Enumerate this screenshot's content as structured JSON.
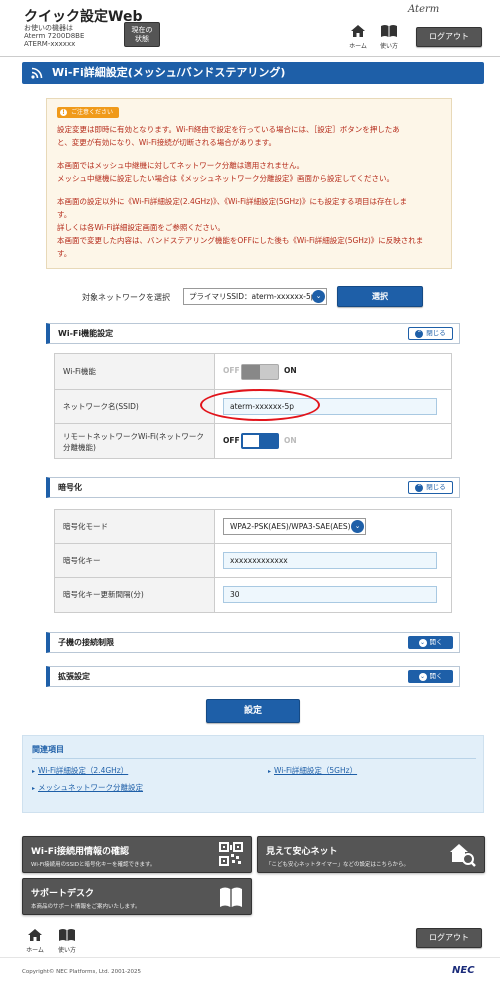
{
  "header": {
    "app_title": "クイック設定Web",
    "device_line1": "お使いの機器は",
    "device_line2": "Aterm 7200D8BE",
    "device_line3": "ATERM-xxxxxx",
    "status_button": [
      "現在の",
      "状態"
    ],
    "home_label": "ホーム",
    "help_label": "使い方",
    "brand": "Aterm",
    "logout": "ログアウト"
  },
  "page": {
    "title": "Wi-Fi詳細設定(メッシュ/バンドステアリング)"
  },
  "notice": {
    "badge": "ご注意ください",
    "lines": [
      "設定変更は即時に有効となります。Wi-Fi経由で設定を行っている場合には、［設定］ボタンを押したあ",
      "と、変更が有効になり、Wi-Fi接続が切断される場合があります。",
      "本画面ではメッシュ中継機に対してネットワーク分離は適用されません。",
      "メッシュ中継機に設定したい場合は《メッシュネットワーク分離設定》画面から設定してください。",
      "本画面の設定以外に《Wi-Fi詳細設定(2.4GHz)》、《Wi-Fi詳細設定(5GHz)》にも設定する項目は存在しま",
      "す。",
      "詳しくは各Wi-Fi詳細設定画面をご参照ください。",
      "本画面で変更した内容は、バンドステアリング機能をOFFにした後も《Wi-Fi詳細設定(5GHz)》に反映されま",
      "す。"
    ]
  },
  "network_select": {
    "label": "対象ネットワークを選択",
    "value": "プライマリSSID：aterm-xxxxxx-5p",
    "button": "選択"
  },
  "wifi_section": {
    "title": "Wi-Fi機能設定",
    "toggle": "閉じる",
    "rows": {
      "wifi_function": {
        "label": "Wi-Fi機能",
        "off": "OFF",
        "on": "ON",
        "state": "on"
      },
      "ssid": {
        "label": "ネットワーク名(SSID)",
        "value": "aterm-xxxxxx-5p"
      },
      "remote_network": {
        "label": "リモートネットワークWi-Fi(ネットワーク分離機能)",
        "off": "OFF",
        "on": "ON",
        "state": "off"
      }
    }
  },
  "encryption_section": {
    "title": "暗号化",
    "toggle": "閉じる",
    "rows": {
      "mode": {
        "label": "暗号化モード",
        "value": "WPA2-PSK(AES)/WPA3-SAE(AES)"
      },
      "key": {
        "label": "暗号化キー",
        "value": "xxxxxxxxxxxxx"
      },
      "interval": {
        "label": "暗号化キー更新間隔(分)",
        "value": "30"
      }
    }
  },
  "child_section": {
    "title": "子機の接続制限",
    "toggle": "開く"
  },
  "ext_section": {
    "title": "拡張設定",
    "toggle": "開く"
  },
  "apply_button": "設定",
  "related": {
    "heading": "関連項目",
    "links": [
      "Wi-Fi詳細設定（2.4GHz）",
      "Wi-Fi詳細設定（5GHz）",
      "メッシュネットワーク分離設定"
    ]
  },
  "tiles": {
    "wifi_info": {
      "title": "Wi-Fi接続用情報の確認",
      "sub": "Wi-Fi接続用のSSIDと暗号化キーを確認できます。"
    },
    "safe_net": {
      "title": "見えて安心ネット",
      "sub": "「こども安心ネットタイマー」などの設定はこちらから。"
    },
    "support": {
      "title": "サポートデスク",
      "sub": "本商品のサポート情報をご案内いたします。"
    }
  },
  "footer": {
    "home_label": "ホーム",
    "help_label": "使い方",
    "logout": "ログアウト",
    "copyright": "Copyright© NEC Platforms, Ltd. 2001-2025",
    "maker": "NEC"
  },
  "colors": {
    "primary": "#1e5fa8",
    "warning": "#b52b1a",
    "badge": "#f09a1a",
    "highlight": "#e2141b"
  }
}
